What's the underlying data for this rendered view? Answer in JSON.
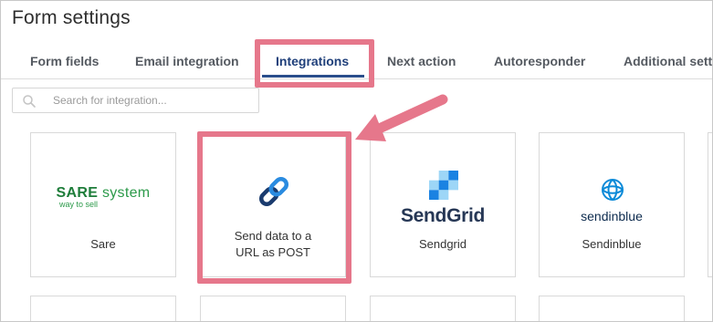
{
  "header": {
    "title": "Form settings"
  },
  "tabs": [
    {
      "label": "Form fields",
      "active": false
    },
    {
      "label": "Email integration",
      "active": false
    },
    {
      "label": "Integrations",
      "active": true
    },
    {
      "label": "Next action",
      "active": false
    },
    {
      "label": "Autoresponder",
      "active": false
    },
    {
      "label": "Additional setti",
      "active": false
    }
  ],
  "search": {
    "placeholder": "Search for integration...",
    "value": ""
  },
  "integrations": [
    {
      "name": "Sare",
      "logo_main": "SARE",
      "logo_main_suffix": "system",
      "logo_tagline": "way to sell",
      "icon": "sare-logo"
    },
    {
      "name": "Send data to a URL as POST",
      "name_line1": "Send data to a",
      "name_line2": "URL as POST",
      "icon": "chain-link-icon"
    },
    {
      "name": "Sendgrid",
      "logo_text": "SendGrid",
      "icon": "sendgrid-logo"
    },
    {
      "name": "Sendinblue",
      "logo_text": "sendinblue",
      "icon": "sendinblue-logo"
    }
  ],
  "colors": {
    "highlight": "#e6778b",
    "active_tab": "#1f3f7a",
    "sare_green": "#1e7d3a",
    "sendgrid_blue": "#1a82e2",
    "sendgrid_text": "#263755",
    "sendinblue_blue": "#0b8ad8"
  }
}
